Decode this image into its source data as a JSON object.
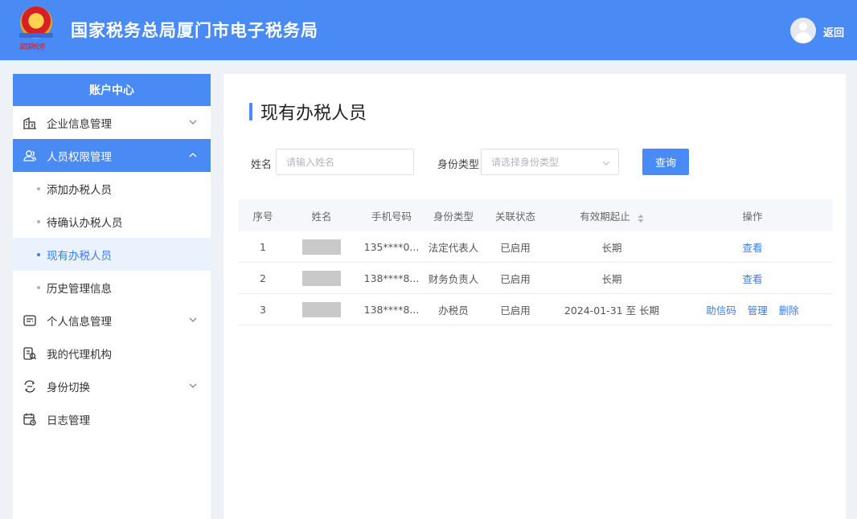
{
  "header": {
    "site_title": "国家税务总局厦门市电子税务局",
    "logo_signature": "掌国税务",
    "back_label": "返回",
    "accent": "#4a8af4"
  },
  "sidebar": {
    "title": "账户中心",
    "items": [
      {
        "label": "企业信息管理",
        "icon": "building-icon",
        "expanded": false
      },
      {
        "label": "人员权限管理",
        "icon": "people-icon",
        "expanded": true,
        "active": true,
        "children": [
          {
            "label": "添加办税人员"
          },
          {
            "label": "待确认办税人员"
          },
          {
            "label": "现有办税人员",
            "current": true
          },
          {
            "label": "历史管理信息"
          }
        ]
      },
      {
        "label": "个人信息管理",
        "icon": "id-card-icon",
        "expanded": false
      },
      {
        "label": "我的代理机构",
        "icon": "agency-icon"
      },
      {
        "label": "身份切换",
        "icon": "switch-icon",
        "expanded": false
      },
      {
        "label": "日志管理",
        "icon": "calendar-log-icon"
      }
    ]
  },
  "main": {
    "page_title": "现有办税人员",
    "filters": {
      "name_label": "姓名",
      "name_placeholder": "请输入姓名",
      "type_label": "身份类型",
      "type_placeholder": "请选择身份类型",
      "query_label": "查询"
    },
    "table": {
      "headers": [
        "序号",
        "姓名",
        "手机号码",
        "身份类型",
        "关联状态",
        "有效期起止",
        "操作"
      ],
      "rows": [
        {
          "index": "1",
          "phone": "135****0...",
          "identity": "法定代表人",
          "status": "已启用",
          "validity": "长期",
          "actions": [
            "查看"
          ]
        },
        {
          "index": "2",
          "phone": "138****8...",
          "identity": "财务负责人",
          "status": "已启用",
          "validity": "长期",
          "actions": [
            "查看"
          ]
        },
        {
          "index": "3",
          "phone": "138****8...",
          "identity": "办税员",
          "status": "已启用",
          "validity": "2024-01-31 至 长期",
          "actions": [
            "助信码",
            "管理",
            "删除"
          ]
        }
      ]
    }
  }
}
